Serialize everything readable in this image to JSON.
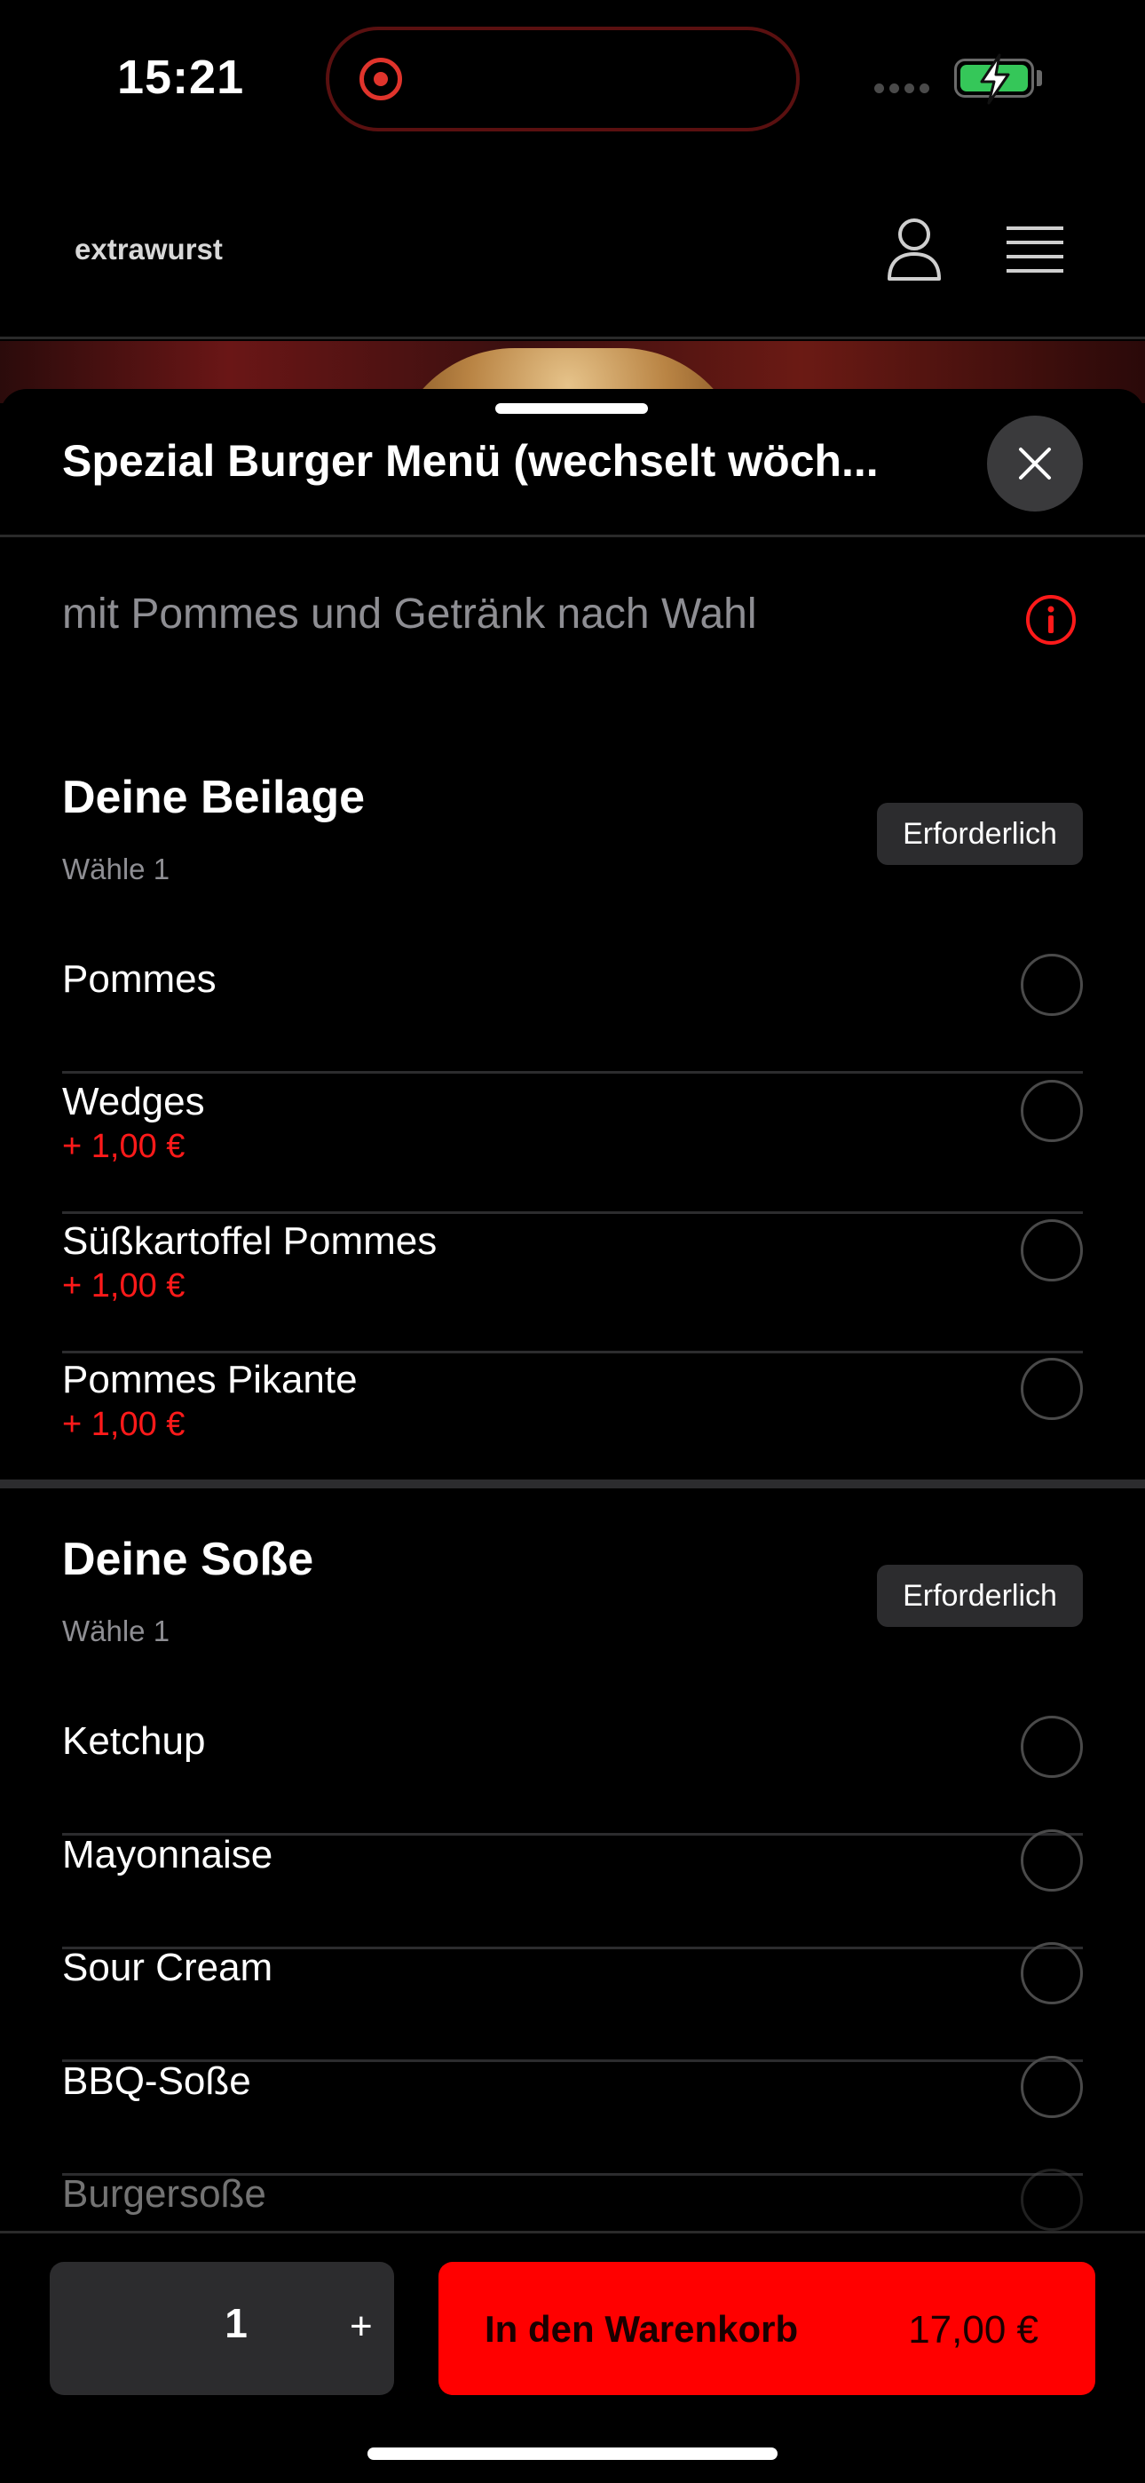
{
  "status_bar": {
    "time": "15:21"
  },
  "header": {
    "brand": "extrawurst"
  },
  "sheet": {
    "title": "Spezial Burger Menü (wechselt wöch...",
    "subtitle": "mit Pommes und Getränk nach Wahl"
  },
  "sections": [
    {
      "title": "Deine Beilage",
      "hint": "Wähle 1",
      "badge": "Erforderlich",
      "options": [
        {
          "name": "Pommes",
          "price": ""
        },
        {
          "name": "Wedges",
          "price": "+ 1,00 €"
        },
        {
          "name": "Süßkartoffel Pommes",
          "price": "+ 1,00 €"
        },
        {
          "name": "Pommes Pikante",
          "price": "+ 1,00 €"
        }
      ]
    },
    {
      "title": "Deine Soße",
      "hint": "Wähle 1",
      "badge": "Erforderlich",
      "options": [
        {
          "name": "Ketchup"
        },
        {
          "name": "Mayonnaise"
        },
        {
          "name": "Sour Cream"
        },
        {
          "name": "BBQ-Soße"
        },
        {
          "name": "Burgersoße"
        }
      ]
    }
  ],
  "footer": {
    "quantity": "1",
    "plus": "+",
    "cart_label": "In den Warenkorb",
    "cart_price": "17,00 €"
  },
  "colors": {
    "accent": "#ff0000",
    "price": "#ff1a1a",
    "badge_bg": "#2c2c2e"
  }
}
